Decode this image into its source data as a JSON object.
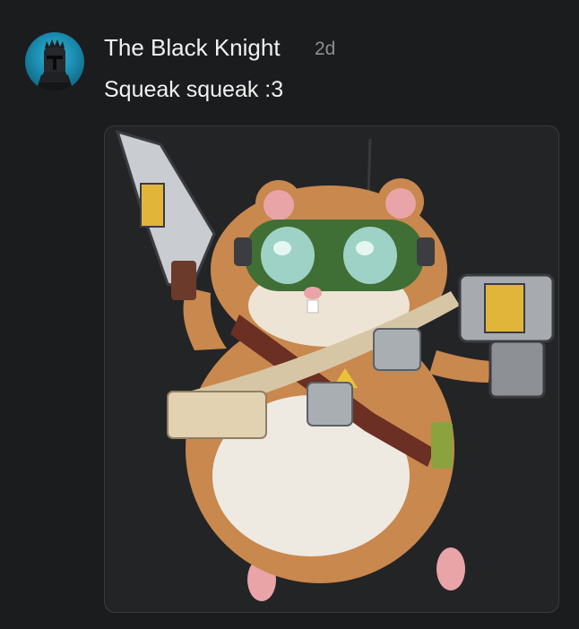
{
  "post": {
    "author": "The Black Knight",
    "timestamp": "2d",
    "message": "Squeak squeak :3",
    "avatar_icon": "knight-helmet-icon",
    "attachment": {
      "type": "image",
      "subject": "hamster-with-goggles-and-guns-illustration"
    }
  },
  "colors": {
    "background": "#1b1c1e",
    "text": "#f1f1f1",
    "muted": "#8d8e92",
    "avatar_blue": "#1a8cb0",
    "card_border": "#3a3b3e"
  }
}
